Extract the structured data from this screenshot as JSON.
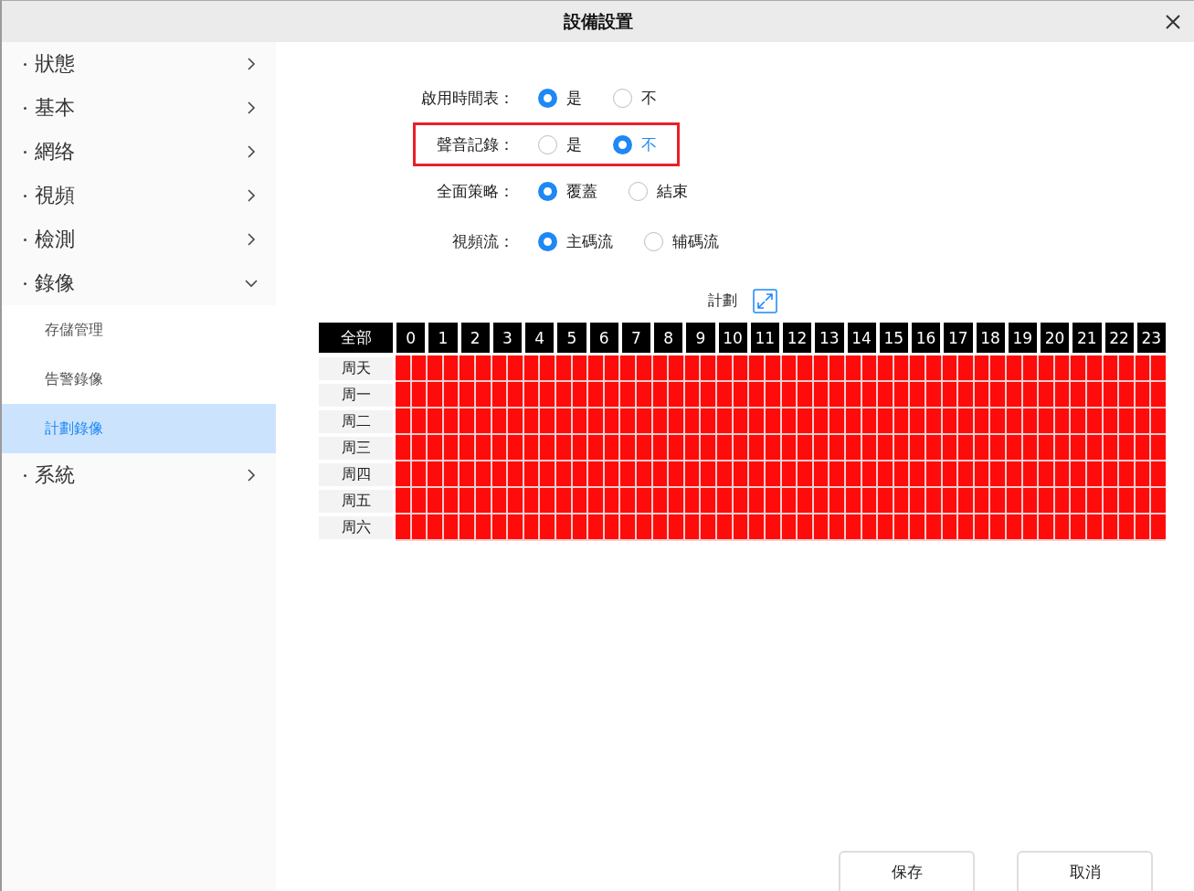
{
  "window": {
    "title": "設備設置"
  },
  "sidebar": {
    "items": [
      {
        "label": "狀態",
        "expanded": false
      },
      {
        "label": "基本",
        "expanded": false
      },
      {
        "label": "網络",
        "expanded": false
      },
      {
        "label": "視頻",
        "expanded": false
      },
      {
        "label": "檢測",
        "expanded": false
      },
      {
        "label": "錄像",
        "expanded": true,
        "children": [
          {
            "label": "存儲管理",
            "selected": false
          },
          {
            "label": "告警錄像",
            "selected": false
          },
          {
            "label": "計劃錄像",
            "selected": true
          }
        ]
      },
      {
        "label": "系統",
        "expanded": false
      }
    ]
  },
  "form": [
    {
      "label": "啟用時間表：",
      "highlighted": false,
      "options": [
        {
          "label": "是",
          "selected": true,
          "focused": false
        },
        {
          "label": "不",
          "selected": false,
          "focused": false
        }
      ]
    },
    {
      "label": "聲音記錄：",
      "highlighted": true,
      "options": [
        {
          "label": "是",
          "selected": false,
          "focused": false
        },
        {
          "label": "不",
          "selected": true,
          "focused": true
        }
      ]
    },
    {
      "label": "全面策略：",
      "highlighted": false,
      "options": [
        {
          "label": "覆蓋",
          "selected": true,
          "focused": false
        },
        {
          "label": "結束",
          "selected": false,
          "focused": false
        }
      ]
    },
    {
      "label": "視頻流：",
      "highlighted": false,
      "options": [
        {
          "label": "主碼流",
          "selected": true,
          "focused": false
        },
        {
          "label": "辅碼流",
          "selected": false,
          "focused": false
        }
      ]
    }
  ],
  "schedule": {
    "title": "計劃",
    "all_label": "全部",
    "hours": [
      "0",
      "1",
      "2",
      "3",
      "4",
      "5",
      "6",
      "7",
      "8",
      "9",
      "10",
      "11",
      "12",
      "13",
      "14",
      "15",
      "16",
      "17",
      "18",
      "19",
      "20",
      "21",
      "22",
      "23"
    ],
    "rows": [
      {
        "day": "周天",
        "slots": [
          true,
          true,
          true,
          true,
          true,
          true,
          true,
          true,
          true,
          true,
          true,
          true,
          true,
          true,
          true,
          true,
          true,
          true,
          true,
          true,
          true,
          true,
          true,
          true,
          true,
          true,
          true,
          true,
          true,
          true,
          true,
          true,
          true,
          true,
          true,
          true,
          true,
          true,
          true,
          true,
          true,
          true,
          true,
          true,
          true,
          true,
          true,
          true
        ]
      },
      {
        "day": "周一",
        "slots": [
          true,
          true,
          true,
          true,
          true,
          true,
          true,
          true,
          true,
          true,
          true,
          true,
          true,
          true,
          true,
          true,
          true,
          true,
          true,
          true,
          true,
          true,
          true,
          true,
          true,
          true,
          true,
          true,
          true,
          true,
          true,
          true,
          true,
          true,
          true,
          true,
          true,
          true,
          true,
          true,
          true,
          true,
          true,
          true,
          true,
          true,
          true,
          true
        ]
      },
      {
        "day": "周二",
        "slots": [
          true,
          true,
          true,
          true,
          true,
          true,
          true,
          true,
          true,
          true,
          true,
          true,
          true,
          true,
          true,
          true,
          true,
          true,
          true,
          true,
          true,
          true,
          true,
          true,
          true,
          true,
          true,
          true,
          true,
          true,
          true,
          true,
          true,
          true,
          true,
          true,
          true,
          true,
          true,
          true,
          true,
          true,
          true,
          true,
          true,
          true,
          true,
          true
        ]
      },
      {
        "day": "周三",
        "slots": [
          true,
          true,
          true,
          true,
          true,
          true,
          true,
          true,
          true,
          true,
          true,
          true,
          true,
          true,
          true,
          true,
          true,
          true,
          true,
          true,
          true,
          true,
          true,
          true,
          true,
          true,
          true,
          true,
          true,
          true,
          true,
          true,
          true,
          true,
          true,
          true,
          true,
          true,
          true,
          true,
          true,
          true,
          true,
          true,
          true,
          true,
          true,
          true
        ]
      },
      {
        "day": "周四",
        "slots": [
          true,
          true,
          true,
          true,
          true,
          true,
          true,
          true,
          true,
          true,
          true,
          true,
          true,
          true,
          true,
          true,
          true,
          true,
          true,
          true,
          true,
          true,
          true,
          true,
          true,
          true,
          true,
          true,
          true,
          true,
          true,
          true,
          true,
          true,
          true,
          true,
          true,
          true,
          true,
          true,
          true,
          true,
          true,
          true,
          true,
          true,
          true,
          true
        ]
      },
      {
        "day": "周五",
        "slots": [
          true,
          true,
          true,
          true,
          true,
          true,
          true,
          true,
          true,
          true,
          true,
          true,
          true,
          true,
          true,
          true,
          true,
          true,
          true,
          true,
          true,
          true,
          true,
          true,
          true,
          true,
          true,
          true,
          true,
          true,
          true,
          true,
          true,
          true,
          true,
          true,
          true,
          true,
          true,
          true,
          true,
          true,
          true,
          true,
          true,
          true,
          true,
          true
        ]
      },
      {
        "day": "周六",
        "slots": [
          true,
          true,
          true,
          true,
          true,
          true,
          true,
          true,
          true,
          true,
          true,
          true,
          true,
          true,
          true,
          true,
          true,
          true,
          true,
          true,
          true,
          true,
          true,
          true,
          true,
          true,
          true,
          true,
          true,
          true,
          true,
          true,
          true,
          true,
          true,
          true,
          true,
          true,
          true,
          true,
          true,
          true,
          true,
          true,
          true,
          true,
          true,
          true
        ]
      }
    ]
  },
  "buttons": [
    "保存",
    "取消"
  ]
}
